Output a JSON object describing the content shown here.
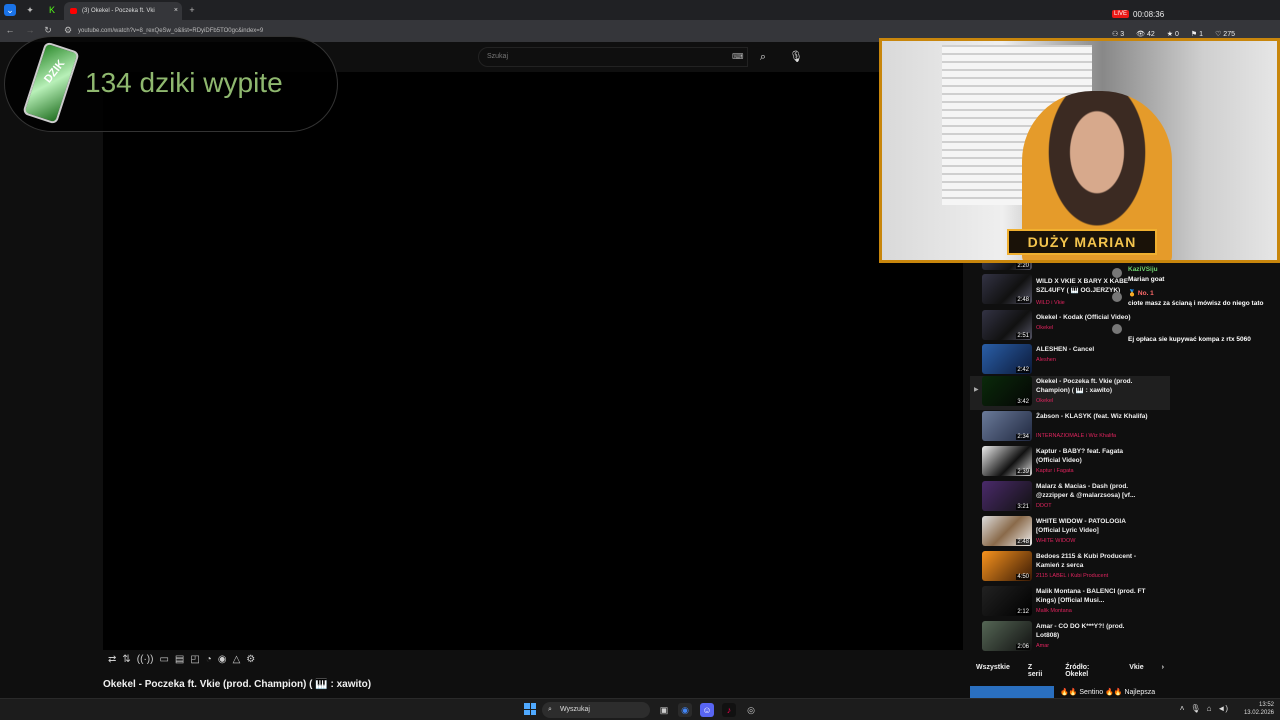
{
  "browser": {
    "tab_title": "(3) Okekel - Poczeka ft. Vki",
    "url": "youtube.com/watch?v=8_rexQeSw_o&list=RDyiDFb5TO0gc&index=9",
    "new_tab": "+",
    "close": "×"
  },
  "youtube": {
    "search_placeholder": "Szukaj",
    "video_title": "Okekel - Poczeka ft. Vkie (prod. Champion) ( 🎹 : xawito)",
    "chips": [
      "Wszystkie",
      "Z serii",
      "Źródło: Okekel",
      "Vkie"
    ],
    "next_row_text": "🔥🔥 Sentino 🔥🔥 Najlepsza",
    "playlist": [
      {
        "title": "",
        "channel": "",
        "duration": "2:20"
      },
      {
        "title": "WILD X VKIE X BARY X KABE SZL4UFY ( 🎹 OG.JERZYK)",
        "channel": "WILD i Vkie",
        "duration": "2:48"
      },
      {
        "title": "Okekel - Kodak (Official Video)",
        "channel": "Okekel",
        "duration": "2:51"
      },
      {
        "title": "ALESHEN - Cancel",
        "channel": "Aleshen",
        "duration": "2:42"
      },
      {
        "title": "Okekel - Poczeka ft. Vkie (prod. Champion) ( 🎹 : xawito)",
        "channel": "Okekel",
        "duration": "3:42"
      },
      {
        "title": "Żabson - KLASYK (feat. Wiz Khalifa)",
        "channel": "INTERNAZIOMALE i Wiz Khalifa",
        "duration": "2:34"
      },
      {
        "title": "Kaptur - BABY? feat. Fagata (Official Video)",
        "channel": "Kaptur i Fagata",
        "duration": "2:39"
      },
      {
        "title": "Malarz & Macias - Dash (prod. @zzzipper & @malarzsosa) [vf...",
        "channel": "DDOT",
        "duration": "3:21"
      },
      {
        "title": "WHITE WIDOW - PATOLOGIA [Official Lyric Video]",
        "channel": "WHITE WIDOW",
        "duration": "2:48"
      },
      {
        "title": "Bedoes 2115 & Kubi Producent - Kamień z serca",
        "channel": "2115 LABEL i Kubi Producent",
        "duration": "4:50"
      },
      {
        "title": "Malik Montana - BALENCI (prod. FT Kings) [Official Musi...",
        "channel": "Malik Montana",
        "duration": "2:12"
      },
      {
        "title": "Amar - CO DO K***Y?! (prod. Lot808)",
        "channel": "Amar",
        "duration": "2:06"
      }
    ]
  },
  "overlay": {
    "counter_text": "134 dziki wypite",
    "can_label": "DZIK"
  },
  "stream": {
    "live_badge": "LIVE",
    "timer": "00:08:36",
    "stats": [
      "3",
      "42",
      "0",
      "1",
      "275"
    ],
    "streamer_name": "DUŻY MARIAN"
  },
  "chat": [
    {
      "user": "KaziVSiju",
      "text": "Marian goat"
    },
    {
      "user": "🏅 No. 1",
      "text": "ciote masz za ścianą i mówisz do niego tato"
    },
    {
      "user": "",
      "text": "Ej opłaca sie kupywać kompa z rtx 5060"
    }
  ],
  "taskbar": {
    "search": "Wyszukaj",
    "time": "13:52",
    "date": "13.02.2026"
  }
}
